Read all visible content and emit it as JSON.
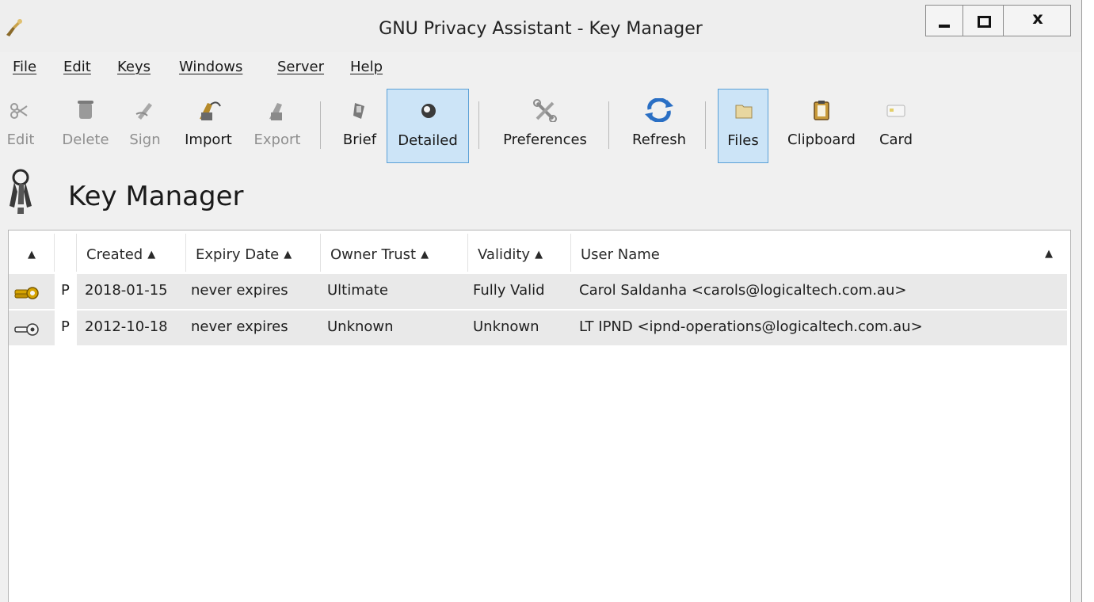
{
  "window": {
    "title": "GNU Privacy Assistant - Key Manager",
    "controls": {
      "minimize": "minimize",
      "maximize": "maximize",
      "close": "x"
    }
  },
  "menubar": [
    "File",
    "Edit",
    "Keys",
    "Windows",
    "Server",
    "Help"
  ],
  "toolbar": {
    "edit": {
      "label": "Edit",
      "icon": "edit-scissors-icon",
      "enabled": false
    },
    "delete": {
      "label": "Delete",
      "icon": "trash-icon",
      "enabled": false
    },
    "sign": {
      "label": "Sign",
      "icon": "sign-pen-icon",
      "enabled": false
    },
    "import": {
      "label": "Import",
      "icon": "import-icon",
      "enabled": true
    },
    "export": {
      "label": "Export",
      "icon": "export-icon",
      "enabled": false
    },
    "brief": {
      "label": "Brief",
      "icon": "brief-view-icon",
      "active": false
    },
    "detailed": {
      "label": "Detailed",
      "icon": "detailed-view-icon",
      "active": true
    },
    "preferences": {
      "label": "Preferences",
      "icon": "preferences-icon"
    },
    "refresh": {
      "label": "Refresh",
      "icon": "refresh-icon"
    },
    "files": {
      "label": "Files",
      "icon": "folder-icon",
      "active": true
    },
    "clipboard": {
      "label": "Clipboard",
      "icon": "clipboard-icon"
    },
    "card": {
      "label": "Card",
      "icon": "smartcard-icon"
    }
  },
  "page": {
    "title": "Key Manager"
  },
  "keylist": {
    "columns": [
      {
        "label": "",
        "sorted": true
      },
      {
        "label": "",
        "sorted": false
      },
      {
        "label": "Created",
        "sorted": true
      },
      {
        "label": "Expiry Date",
        "sorted": true
      },
      {
        "label": "Owner Trust",
        "sorted": true
      },
      {
        "label": "Validity",
        "sorted": true
      },
      {
        "label": "User Name",
        "sorted": true
      }
    ],
    "sort_arrow": "▲",
    "rows": [
      {
        "key_type_icon": "keypair-icon",
        "type": "P",
        "created": "2018-01-15",
        "expiry": "never expires",
        "owner_trust": "Ultimate",
        "validity": "Fully Valid",
        "user_name": "Carol Saldanha <carols@logicaltech.com.au>"
      },
      {
        "key_type_icon": "public-key-icon",
        "type": "P",
        "created": "2012-10-18",
        "expiry": "never expires",
        "owner_trust": "Unknown",
        "validity": "Unknown",
        "user_name": "LT IPND <ipnd-operations@logicaltech.com.au>"
      }
    ]
  },
  "colors": {
    "active_button_bg": "#cce4f7",
    "active_button_border": "#5aa0d6",
    "row_bg": "#e9e9e9",
    "key_gold": "#d6a400"
  }
}
